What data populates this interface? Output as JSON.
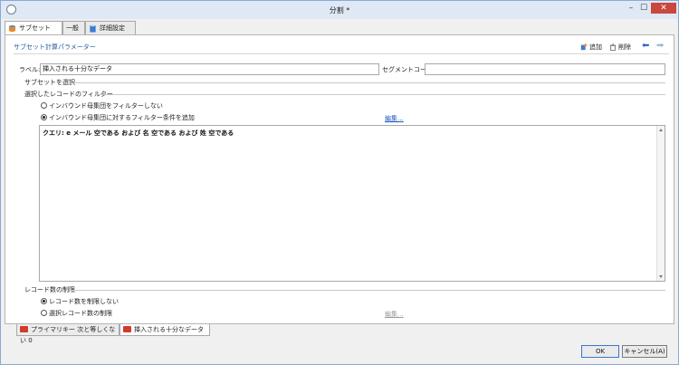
{
  "window": {
    "title": "分割 *",
    "minimize": "–",
    "maximize": "☐",
    "close": "✕"
  },
  "tabs": [
    {
      "label": "サブセット"
    },
    {
      "label": "一般"
    },
    {
      "label": "詳細設定"
    }
  ],
  "section": {
    "title": "サブセット計算パラメーター",
    "add_label": "追加",
    "delete_label": "削除"
  },
  "fields": {
    "label_caption": "ラベル:",
    "label_value": "挿入される十分なデータ",
    "segment_caption": "セグメントコード:",
    "segment_value": ""
  },
  "subset_select": {
    "title": "サブセットを選択",
    "filter_group_title": "選択したレコードのフィルター",
    "radio_no_filter": "インバウンド母集団をフィルターしない",
    "radio_add_filter": "インバウンド母集団に対するフィルター条件を追加",
    "edit_link": "編集...",
    "query_text": "クエリ: e メール 空である および 名 空である および 姓 空である"
  },
  "limit": {
    "title": "レコード数の制限",
    "radio_no_limit": "レコード数を制限しない",
    "radio_limit": "選択レコード数の制限",
    "edit_link": "編集..."
  },
  "bottom_tabs": [
    {
      "label": "プライマリキー 次と等しくない 0"
    },
    {
      "label": "挿入される十分なデータ"
    }
  ],
  "buttons": {
    "ok": "OK",
    "cancel": "キャンセル(A)"
  },
  "colors": {
    "accent": "#1f5aa6",
    "link": "#1a56c4",
    "close_button": "#c9473d",
    "tab_icon_red": "#d13a2f"
  }
}
